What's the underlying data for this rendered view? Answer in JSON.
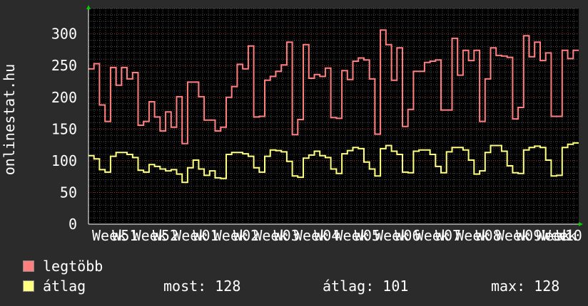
{
  "chart_data": {
    "type": "line",
    "ylabel": "onlinestat.hu",
    "ylim": [
      0,
      340
    ],
    "yticks": [
      0,
      50,
      100,
      150,
      200,
      250,
      300
    ],
    "grid": true,
    "xticks": [
      "Week",
      "W51",
      "Week",
      "W52",
      "Week",
      "W01",
      "Week",
      "W02",
      "Week",
      "W03",
      "Week",
      "W04",
      "Week",
      "W05",
      "Week",
      "W06",
      "Week",
      "W07",
      "Week",
      "W08",
      "Week",
      "W09",
      "Week",
      "W10",
      "Week"
    ],
    "series": [
      {
        "name": "legtöbb",
        "color": "#ff7f7f",
        "values": [
          245,
          253,
          188,
          162,
          247,
          219,
          247,
          229,
          239,
          156,
          162,
          193,
          169,
          147,
          177,
          153,
          201,
          127,
          224,
          224,
          201,
          164,
          164,
          147,
          153,
          200,
          217,
          252,
          245,
          281,
          169,
          170,
          227,
          233,
          241,
          251,
          287,
          141,
          165,
          283,
          230,
          236,
          233,
          246,
          168,
          167,
          242,
          228,
          257,
          262,
          259,
          229,
          142,
          306,
          283,
          227,
          278,
          154,
          181,
          241,
          241,
          255,
          257,
          259,
          180,
          180,
          293,
          235,
          274,
          258,
          274,
          162,
          229,
          278,
          266,
          265,
          263,
          166,
          184,
          297,
          264,
          287,
          258,
          270,
          170,
          170,
          274,
          261,
          274
        ]
      },
      {
        "name": "átlag",
        "color": "#ffff80",
        "values": [
          108,
          103,
          86,
          82,
          107,
          113,
          113,
          110,
          105,
          85,
          82,
          94,
          91,
          87,
          84,
          86,
          79,
          66,
          89,
          101,
          87,
          77,
          84,
          73,
          72,
          110,
          113,
          113,
          111,
          107,
          89,
          82,
          107,
          117,
          116,
          114,
          99,
          76,
          74,
          104,
          109,
          115,
          108,
          105,
          87,
          80,
          111,
          116,
          121,
          119,
          98,
          87,
          76,
          119,
          124,
          115,
          110,
          82,
          81,
          115,
          117,
          117,
          110,
          91,
          81,
          114,
          121,
          121,
          117,
          101,
          79,
          84,
          113,
          124,
          124,
          115,
          92,
          81,
          80,
          117,
          121,
          123,
          121,
          101,
          76,
          77,
          121,
          126,
          128
        ]
      }
    ],
    "legend": "bottom-left"
  },
  "legend": {
    "max_label": "legtöbb",
    "avg_label": "átlag"
  },
  "stats": {
    "current": "most: 128",
    "average": "átlag: 101",
    "maximum": "max: 128"
  }
}
